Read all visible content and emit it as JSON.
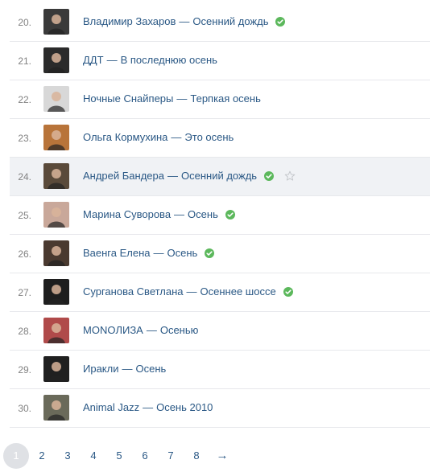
{
  "tracks": [
    {
      "num": "20.",
      "artist": "Владимир Захаров",
      "song": "Осенний дождь",
      "verified": true,
      "star": false,
      "hovered": false,
      "avatar_color": "#3a3a3a"
    },
    {
      "num": "21.",
      "artist": "ДДТ",
      "song": "В последнюю осень",
      "verified": false,
      "star": false,
      "hovered": false,
      "avatar_color": "#2b2b2b"
    },
    {
      "num": "22.",
      "artist": "Ночные Снайперы",
      "song": "Терпкая осень",
      "verified": false,
      "star": false,
      "hovered": false,
      "avatar_color": "#d8d8d8"
    },
    {
      "num": "23.",
      "artist": "Ольга Кормухина",
      "song": "Это осень",
      "verified": false,
      "star": false,
      "hovered": false,
      "avatar_color": "#b8743a"
    },
    {
      "num": "24.",
      "artist": "Андрей Бандера",
      "song": "Осенний дождь",
      "verified": true,
      "star": true,
      "hovered": true,
      "avatar_color": "#5a4a3a"
    },
    {
      "num": "25.",
      "artist": "Марина Суворова",
      "song": "Осень",
      "verified": true,
      "star": false,
      "hovered": false,
      "avatar_color": "#c9a89a"
    },
    {
      "num": "26.",
      "artist": "Ваенга Елена",
      "song": "Осень",
      "verified": true,
      "star": false,
      "hovered": false,
      "avatar_color": "#4a3a30"
    },
    {
      "num": "27.",
      "artist": "Сурганова Светлана",
      "song": "Осеннее шоссе",
      "verified": true,
      "star": false,
      "hovered": false,
      "avatar_color": "#1e1e1e"
    },
    {
      "num": "28.",
      "artist": "MONOЛИЗА",
      "song": "Осенью",
      "verified": false,
      "star": false,
      "hovered": false,
      "avatar_color": "#b04a4a"
    },
    {
      "num": "29.",
      "artist": "Иракли",
      "song": "Осень",
      "verified": false,
      "star": false,
      "hovered": false,
      "avatar_color": "#202020"
    },
    {
      "num": "30.",
      "artist": "Animal Jazz",
      "song": "Осень 2010",
      "verified": false,
      "star": false,
      "hovered": false,
      "avatar_color": "#6a6a5a"
    }
  ],
  "separator": "—",
  "pagination": {
    "pages": [
      "1",
      "2",
      "3",
      "4",
      "5",
      "6",
      "7",
      "8"
    ],
    "current": "1",
    "next": "→"
  },
  "colors": {
    "link": "#2a5885",
    "verified": "#5cb85c",
    "hover_row": "#f0f2f5"
  }
}
